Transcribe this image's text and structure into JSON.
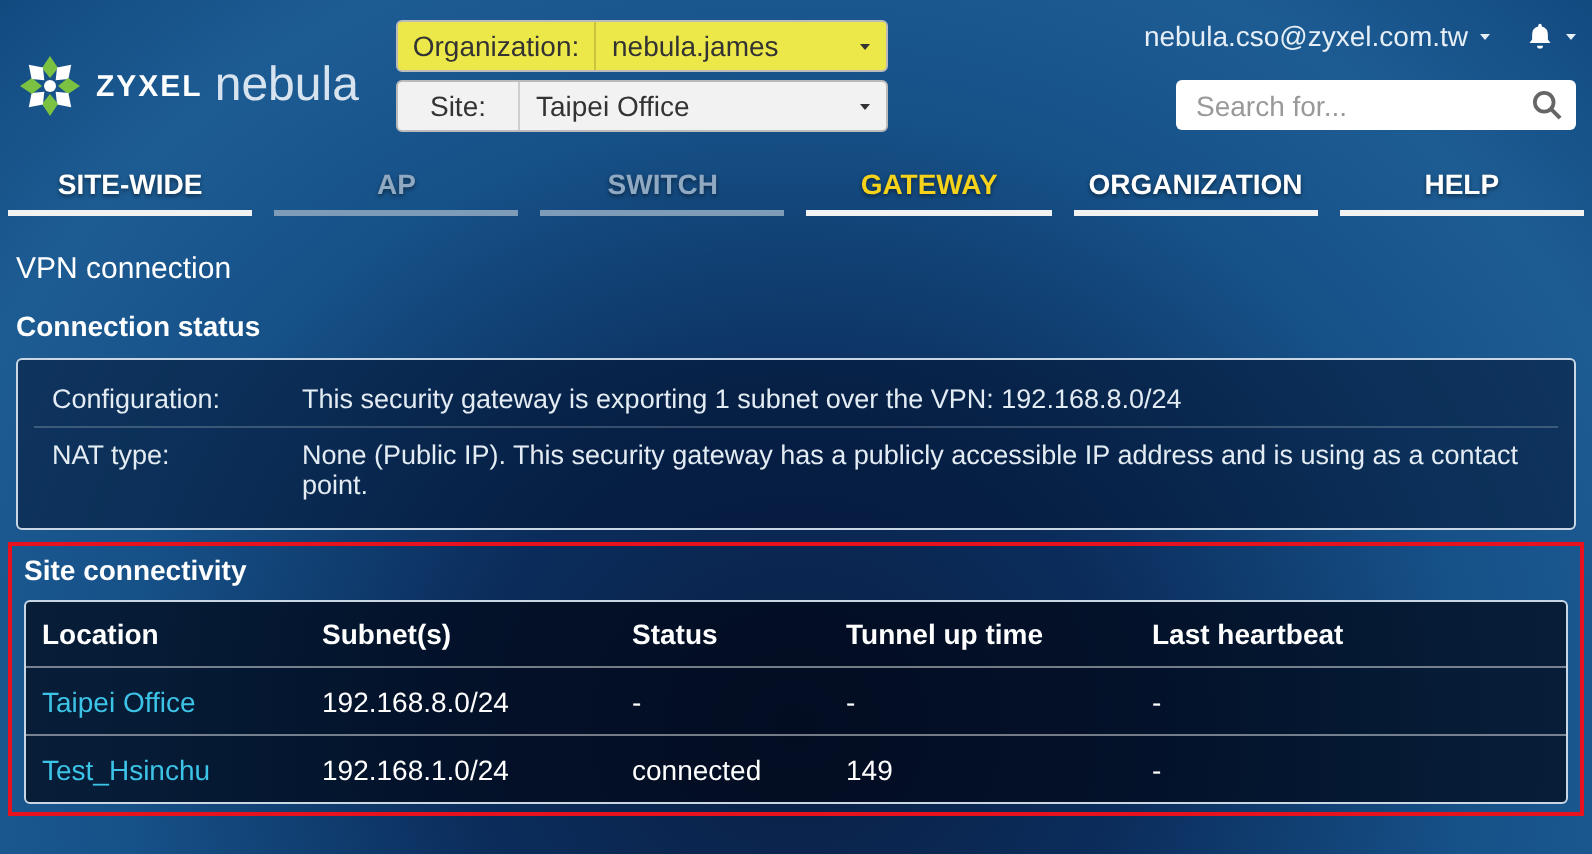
{
  "logo": {
    "brand": "ZYXEL",
    "product": "nebula"
  },
  "selectors": [
    {
      "label": "Organization:",
      "value": "nebula.james",
      "highlighted": true
    },
    {
      "label": "Site:",
      "value": "Taipei Office",
      "highlighted": false
    }
  ],
  "user": {
    "email": "nebula.cso@zyxel.com.tw"
  },
  "search": {
    "placeholder": "Search for..."
  },
  "tabs": [
    {
      "label": "SITE-WIDE",
      "selected": false,
      "disabled": false
    },
    {
      "label": "AP",
      "selected": false,
      "disabled": true
    },
    {
      "label": "SWITCH",
      "selected": false,
      "disabled": true
    },
    {
      "label": "GATEWAY",
      "selected": true,
      "disabled": false
    },
    {
      "label": "ORGANIZATION",
      "selected": false,
      "disabled": false
    },
    {
      "label": "HELP",
      "selected": false,
      "disabled": false
    }
  ],
  "page_title": "VPN connection",
  "connection_status": {
    "title": "Connection status",
    "rows": [
      {
        "label": "Configuration:",
        "value": "This security gateway is exporting 1 subnet over the VPN: 192.168.8.0/24"
      },
      {
        "label": "NAT type:",
        "value": "None (Public IP). This security gateway has a publicly accessible IP address and is using as a contact point."
      }
    ]
  },
  "site_connectivity": {
    "title": "Site connectivity",
    "highlighted": true,
    "columns": [
      "Location",
      "Subnet(s)",
      "Status",
      "Tunnel up time",
      "Last heartbeat"
    ],
    "rows": [
      [
        "Taipei Office",
        "192.168.8.0/24",
        "-",
        "-",
        "-"
      ],
      [
        "Test_Hsinchu",
        "192.168.1.0/24",
        "connected",
        "149",
        "-"
      ]
    ]
  }
}
